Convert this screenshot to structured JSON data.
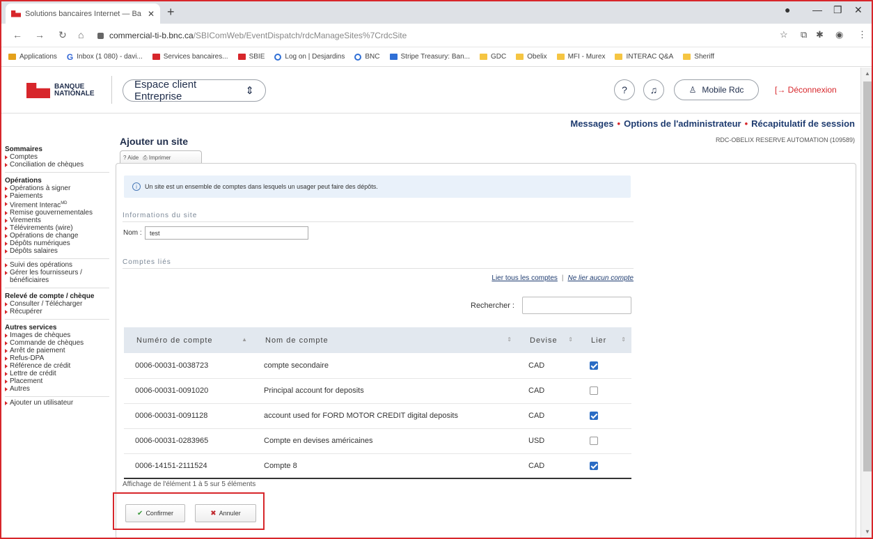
{
  "browser": {
    "tab_title": "Solutions bancaires Internet — Ba",
    "url_domain": "commercial-ti-b.bnc.ca",
    "url_path": "/SBIComWeb/EventDispatch/rdcManageSites%7CrdcSite"
  },
  "bookmarks": [
    "Applications",
    "Inbox (1 080) - davi...",
    "Services bancaires...",
    "SBIE",
    "Log on | Desjardins",
    "BNC",
    "Stripe Treasury: Ban...",
    "GDC",
    "Obelix",
    "MFI - Murex",
    "INTERAC Q&A",
    "Sheriff"
  ],
  "header": {
    "logo_line1": "BANQUE",
    "logo_line2": "NATIONALE",
    "space_selector": "Espace client Entreprise",
    "help_icon": "?",
    "user_button": "Mobile Rdc",
    "logout": "Déconnexion"
  },
  "top_links": {
    "messages": "Messages",
    "admin": "Options de l'administrateur",
    "summary": "Récapitulatif de session",
    "account": "RDC-OBELIX RESERVE AUTOMATION (109589)"
  },
  "nav": {
    "sommaires_title": "Sommaires",
    "sommaires": [
      "Comptes",
      "Conciliation de chèques"
    ],
    "operations_title": "Opérations",
    "operations": [
      "Opérations à signer",
      "Paiements",
      "Virement Interac",
      "Remise gouvernementales",
      "Virements",
      "Télévirements (wire)",
      "Opérations de change",
      "Dépôts numériques",
      "Dépôts salaires"
    ],
    "suivi": [
      "Suivi des opérations",
      "Gérer les fournisseurs / bénéficiaires"
    ],
    "releve_title": "Relevé de compte / chèque",
    "releve": [
      "Consulter / Télécharger",
      "Récupérer"
    ],
    "autres_title": "Autres services",
    "autres": [
      "Images de chèques",
      "Commande de chèques",
      "Arrêt de paiement",
      "Refus-DPA",
      "Référence de crédit",
      "Lettre de crédit",
      "Placement",
      "Autres"
    ],
    "ajouter": "Ajouter un utilisateur",
    "interac_sup": "MD"
  },
  "main": {
    "title": "Ajouter un site",
    "tab_help": "Aide",
    "tab_print": "Imprimer",
    "info": "Un site est un ensemble de comptes dans lesquels un usager peut faire des dépôts.",
    "section_site": "Informations du site",
    "nom_label": "Nom :",
    "nom_value": "test",
    "section_comptes": "Comptes liés",
    "link_all": "Lier tous les comptes",
    "link_none": "Ne lier aucun compte",
    "search_label": "Rechercher :",
    "columns": [
      "Numéro de compte",
      "Nom de compte",
      "Devise",
      "Lier"
    ],
    "rows": [
      {
        "num": "0006-00031-0038723",
        "name": "compte secondaire",
        "cur": "CAD",
        "checked": true
      },
      {
        "num": "0006-00031-0091020",
        "name": "Principal account for deposits",
        "cur": "CAD",
        "checked": false
      },
      {
        "num": "0006-00031-0091128",
        "name": "account used for FORD MOTOR CREDIT digital deposits",
        "cur": "CAD",
        "checked": true
      },
      {
        "num": "0006-00031-0283965",
        "name": "Compte en devises américaines",
        "cur": "USD",
        "checked": false
      },
      {
        "num": "0006-14151-2111524",
        "name": "Compte 8",
        "cur": "CAD",
        "checked": true
      }
    ],
    "footer": "Affichage de l'élément 1 à 5 sur 5 éléments",
    "confirm": "Confirmer",
    "cancel": "Annuler"
  },
  "colors": {
    "brand_red": "#d7262b",
    "navy": "#1f2d4b",
    "checkbox_blue": "#2a6cc4"
  }
}
